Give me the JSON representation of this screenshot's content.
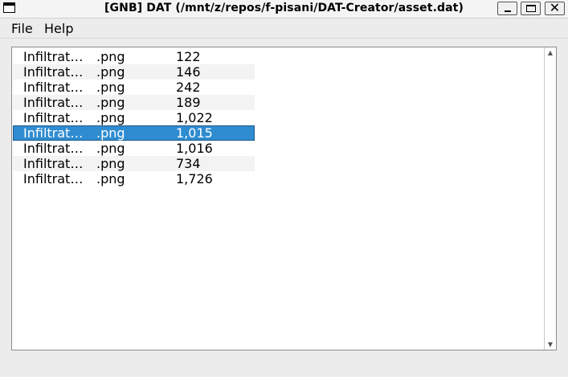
{
  "window": {
    "title": "[GNB] DAT (/mnt/z/repos/f-pisani/DAT-Creator/asset.dat)",
    "minimize_glyph": "",
    "close_glyph": "✕"
  },
  "menu": {
    "file": "File",
    "help": "Help"
  },
  "list": {
    "rows": [
      {
        "name": "Infiltrat…",
        "ext": ".png",
        "size": "122"
      },
      {
        "name": "Infiltrat…",
        "ext": ".png",
        "size": "146"
      },
      {
        "name": "Infiltrat…",
        "ext": ".png",
        "size": "242"
      },
      {
        "name": "Infiltrat…",
        "ext": ".png",
        "size": "189"
      },
      {
        "name": "Infiltrat…",
        "ext": ".png",
        "size": "1,022"
      },
      {
        "name": "Infiltrat…",
        "ext": ".png",
        "size": "1,015"
      },
      {
        "name": "Infiltrat…",
        "ext": ".png",
        "size": "1,016"
      },
      {
        "name": "Infiltrat…",
        "ext": ".png",
        "size": "734"
      },
      {
        "name": "Infiltrat…",
        "ext": ".png",
        "size": "1,726"
      }
    ],
    "selected_index": 5
  },
  "scrollbar": {
    "up_glyph": "▲",
    "down_glyph": "▼"
  },
  "colors": {
    "selection": "#2f8cd0",
    "alt_row": "#f3f3f3"
  }
}
